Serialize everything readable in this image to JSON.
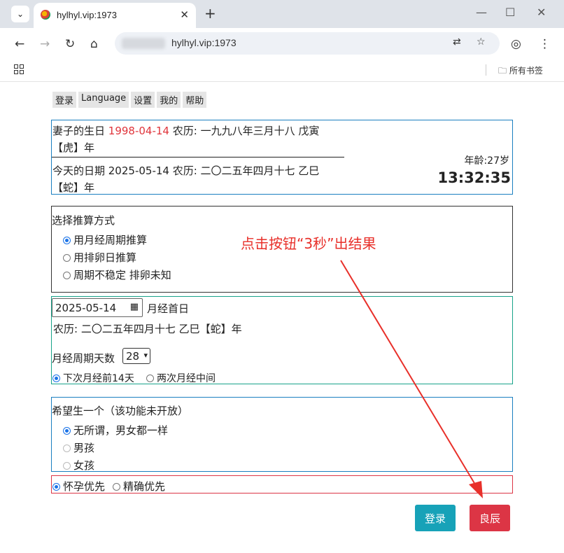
{
  "browser": {
    "tab_title": "hylhyl.vip:1973",
    "url": "hylhyl.vip:1973",
    "bookmarks_label": "所有书签"
  },
  "menu": [
    "登录",
    "Language",
    "设置",
    "我的",
    "帮助"
  ],
  "birthday": {
    "wife_label": "妻子的生日",
    "wife_date": "1998-04-14",
    "wife_lunar": "农历: 一九九八年三月十八 戊寅",
    "wife_zodiac": "【虎】年",
    "today_line": "今天的日期 2025-05-14 农历: 二〇二五年四月十七 乙巳",
    "today_zodiac": "【蛇】年",
    "age": "年龄:27岁",
    "time": "13:32:35"
  },
  "method": {
    "title": "选择推算方式",
    "options": [
      "用月经周期推算",
      "用排卵日推算",
      "周期不稳定 排卵未知"
    ],
    "selected": 0
  },
  "annotation": "点击按钮“3秒”出结果",
  "period": {
    "date_value": "2025-05-14",
    "date_label": "月经首日",
    "lunar": "农历: 二〇二五年四月十七 乙巳【蛇】年",
    "days_label": "月经周期天数",
    "days_value": "28",
    "radio1": "下次月经前14天",
    "radio2": "两次月经中间"
  },
  "gender": {
    "title": "希望生一个（该功能未开放）",
    "options": [
      "无所谓，男女都一样",
      "男孩",
      "女孩"
    ]
  },
  "priority": {
    "opt1": "怀孕优先",
    "opt2": "精确优先"
  },
  "buttons": {
    "login": "登录",
    "lucky": "良辰"
  },
  "colors": {
    "login_btn": "#17a2b8",
    "lucky_btn": "#dc3545",
    "annotation": "#e8302a"
  }
}
